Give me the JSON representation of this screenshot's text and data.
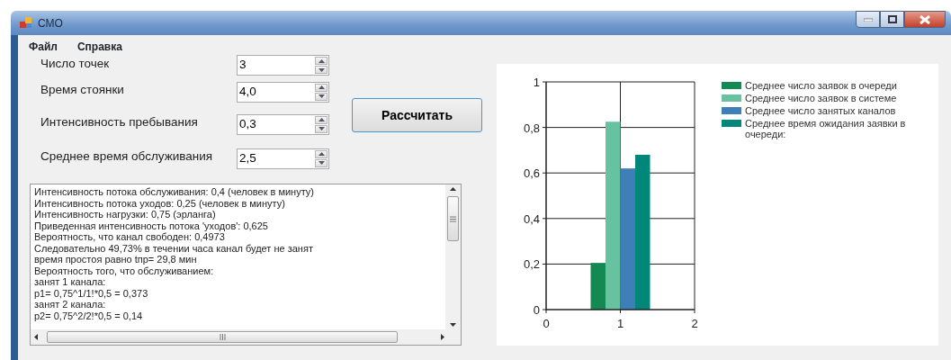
{
  "window": {
    "title": "СМО"
  },
  "menu": [
    "Файл",
    "Справка"
  ],
  "fields": [
    {
      "label": "Число точек",
      "value": "3"
    },
    {
      "label": "Время стоянки",
      "value": "4,0"
    },
    {
      "label": "Интенсивность пребывания",
      "value": "0,3"
    },
    {
      "label": "Среднее время обслуживания",
      "value": "2,5"
    }
  ],
  "calculate_button": "Рассчитать",
  "output_lines": [
    "Интенсивность потока обслуживания: 0,4 (человек в минуту)",
    "Интенсивность потока уходов: 0,25 (человек в минуту)",
    "Интенсивность нагрузки: 0,75 (эрланга)",
    "Приведенная интенсивность потока 'уходов': 0,625",
    "Вероятность, что канал свободен: 0,4973",
    "Следовательно 49,73%   в течении часа канал будет не занят",
    "время простоя равно tпр= 29,8 мин",
    "Вероятность того, что обслуживанием:",
    "занят 1 канала:",
    "p1= 0,75^1/1!*0,5 = 0,373",
    "занят 2 канала:",
    "p2= 0,75^2/2!*0,5 = 0,14"
  ],
  "chart": {
    "chart_data": {
      "type": "bar",
      "grid": true,
      "legend": true,
      "xlim": [
        0,
        2
      ],
      "ylim": [
        0,
        1
      ],
      "xticks": [
        0,
        1,
        2
      ],
      "yticks": [
        {
          "value": 0,
          "label": "0"
        },
        {
          "value": 0.2,
          "label": "0,2"
        },
        {
          "value": 0.4,
          "label": "0,4"
        },
        {
          "value": 0.6,
          "label": "0,6"
        },
        {
          "value": 0.8,
          "label": "0,8"
        },
        {
          "value": 1,
          "label": "1"
        }
      ],
      "series": [
        {
          "name": "Среднее число заявок в очереди",
          "color": "#138a52",
          "x": [
            0.7
          ],
          "values": [
            0.205
          ]
        },
        {
          "name": "Среднее число заявок в системе",
          "color": "#66c2a0",
          "x": [
            0.9
          ],
          "values": [
            0.825
          ]
        },
        {
          "name": "Среднее число занятых каналов",
          "color": "#3f7fb8",
          "x": [
            1.1
          ],
          "values": [
            0.62
          ]
        },
        {
          "name": "Среднее время ожидания заявки в очереди:",
          "color": "#00877a",
          "x": [
            1.3
          ],
          "values": [
            0.68
          ]
        }
      ]
    }
  }
}
